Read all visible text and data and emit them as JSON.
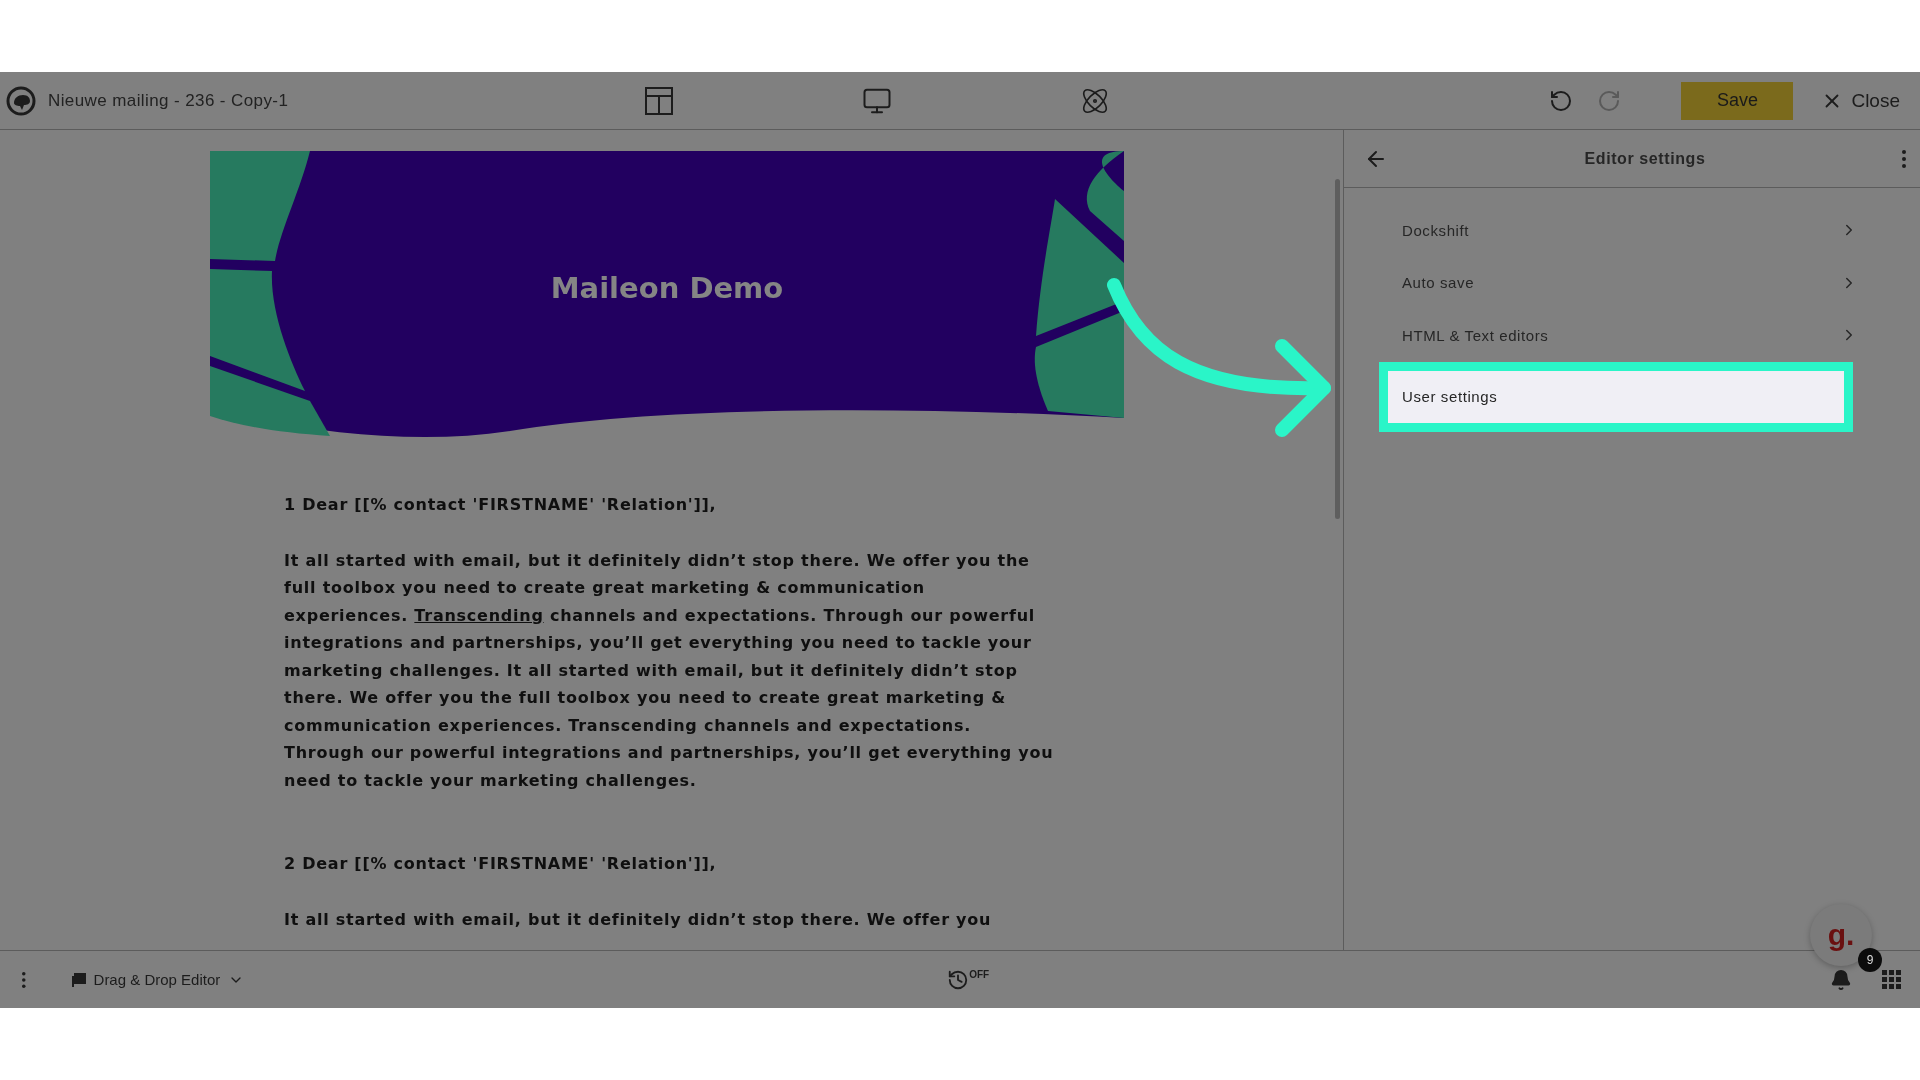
{
  "header": {
    "title": "Nieuwe mailing - 236 - Copy-1",
    "undo": {
      "disabled": false
    },
    "redo": {
      "disabled": true
    },
    "save": "Save",
    "close": "Close"
  },
  "email": {
    "banner_title": "Maileon Demo",
    "paragraphs": [
      {
        "kind": "greeting",
        "text": "1 Dear [[% contact 'FIRSTNAME' 'Relation']],"
      },
      {
        "kind": "body",
        "before": "It all started with email, but it definitely didn’t stop there. We offer you the full toolbox you need to create great marketing & communication experiences. ",
        "link": "Transcending",
        "after": " channels and expectations. Through our powerful integrations and partnerships, you’ll get everything you need to tackle your marketing challenges.  It all started with email, but it definitely didn’t stop there. We offer you the full toolbox you need to create great marketing & communication experiences. Transcending channels and expectations. Through our powerful integrations and partnerships, you’ll get everything you need to tackle your marketing challenges."
      },
      {
        "kind": "greeting",
        "text": "2 Dear [[% contact 'FIRSTNAME' 'Relation']],"
      },
      {
        "kind": "body",
        "before": "It all started with email, but it definitely didn’t stop there. We offer you"
      }
    ]
  },
  "panel": {
    "title": "Editor settings",
    "items": [
      {
        "label": "Dockshift",
        "selected": false
      },
      {
        "label": "Auto save",
        "selected": false
      },
      {
        "label": "HTML & Text editors",
        "selected": false
      },
      {
        "label": "User settings",
        "selected": true
      }
    ]
  },
  "bottom_bar": {
    "editor_mode": "Drag & Drop Editor",
    "autosave": "OFF",
    "chat_logo": "g.",
    "chat_badge": "9"
  }
}
